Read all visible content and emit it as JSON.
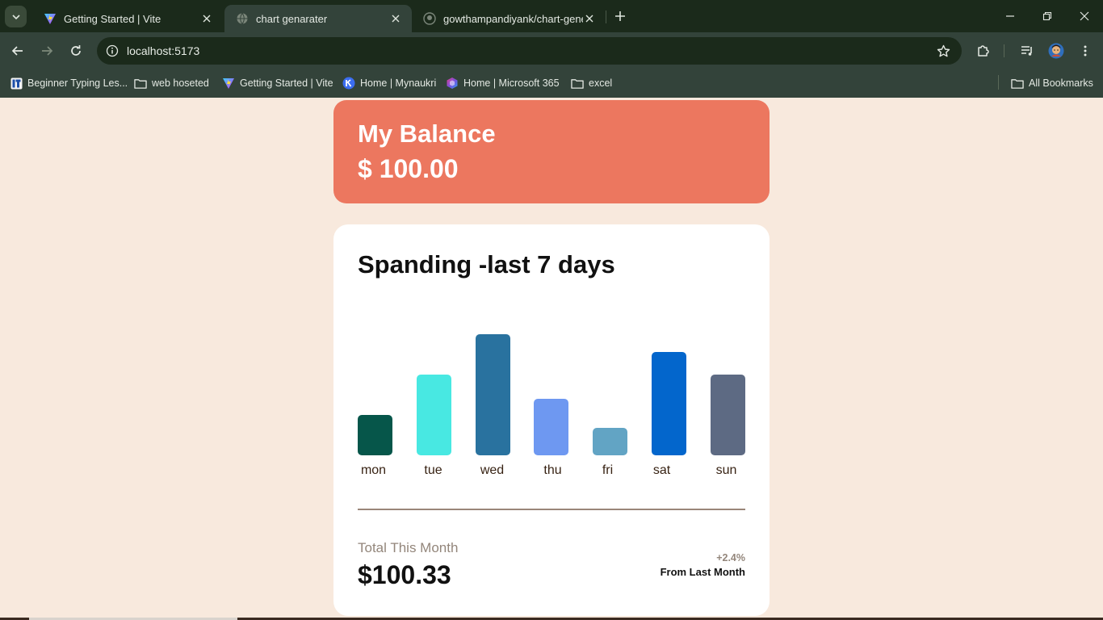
{
  "browser": {
    "tabs": [
      {
        "title": "Getting Started | Vite",
        "icon": "vite-icon",
        "active": false
      },
      {
        "title": "chart genarater",
        "icon": "globe-icon",
        "active": true
      },
      {
        "title": "gowthampandiyank/chart-gene",
        "icon": "github-icon",
        "active": false
      }
    ],
    "address": "localhost:5173",
    "bookmarks": [
      {
        "label": "Beginner Typing Les...",
        "icon": "typing-site-icon"
      },
      {
        "label": "web hoseted",
        "icon": "folder-icon"
      },
      {
        "label": "Getting Started | Vite",
        "icon": "vite-icon"
      },
      {
        "label": "Home | Mynaukri",
        "icon": "naukri-icon"
      },
      {
        "label": "Home | Microsoft 365",
        "icon": "microsoft365-icon"
      },
      {
        "label": "excel",
        "icon": "folder-icon"
      }
    ],
    "all_bookmarks": "All Bookmarks"
  },
  "balance": {
    "label": "My Balance",
    "amount": "$ 100.00",
    "color": "#ec775f"
  },
  "spending": {
    "title": "Spanding -last 7 days",
    "total_label": "Total This Month",
    "total_amount": "$100.33",
    "change": "+2.4%",
    "change_label": "From Last Month"
  },
  "chart_data": {
    "type": "bar",
    "categories": [
      "mon",
      "tue",
      "wed",
      "thu",
      "fri",
      "sat",
      "sun"
    ],
    "values": [
      50,
      100,
      150,
      70,
      34,
      128,
      100
    ],
    "colors": [
      "#06564a",
      "#48e8e2",
      "#29729f",
      "#6e98f1",
      "#62a4c4",
      "#0366cc",
      "#5d6a83"
    ],
    "ylim": [
      0,
      150
    ],
    "grid": false
  }
}
